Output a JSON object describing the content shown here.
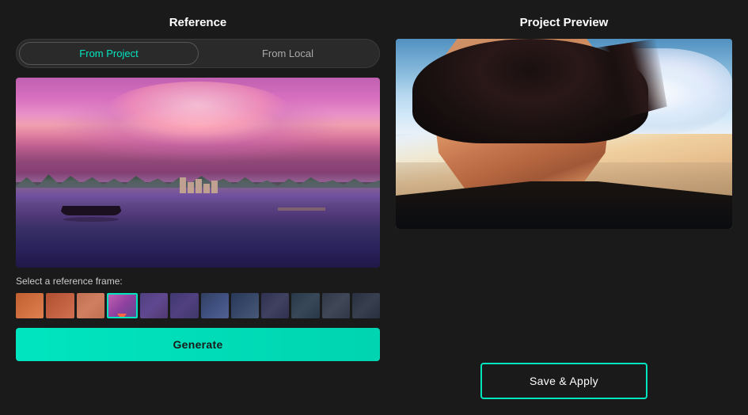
{
  "left_panel": {
    "title": "Reference",
    "tab_from_project": "From Project",
    "tab_from_local": "From Local",
    "select_frame_label": "Select a reference frame:",
    "generate_btn": "Generate",
    "filmstrip": [
      {
        "id": 1,
        "style": "warm",
        "selected": false
      },
      {
        "id": 2,
        "style": "warm",
        "selected": false
      },
      {
        "id": 3,
        "style": "warm",
        "selected": false
      },
      {
        "id": 4,
        "style": "purple",
        "selected": true
      },
      {
        "id": 5,
        "style": "purple",
        "selected": false
      },
      {
        "id": 6,
        "style": "purple",
        "selected": false
      },
      {
        "id": 7,
        "style": "cool",
        "selected": false
      },
      {
        "id": 8,
        "style": "cool",
        "selected": false
      },
      {
        "id": 9,
        "style": "cool",
        "selected": false
      },
      {
        "id": 10,
        "style": "cool",
        "selected": false
      },
      {
        "id": 11,
        "style": "cool",
        "selected": false
      },
      {
        "id": 12,
        "style": "cool",
        "selected": false
      }
    ]
  },
  "right_panel": {
    "title": "Project Preview",
    "save_apply_btn": "Save & Apply"
  },
  "colors": {
    "bg": "#1a1a1a",
    "accent": "#00e5c0",
    "active_tab_text": "#00e5c0",
    "inactive_tab_text": "#aaaaaa"
  }
}
